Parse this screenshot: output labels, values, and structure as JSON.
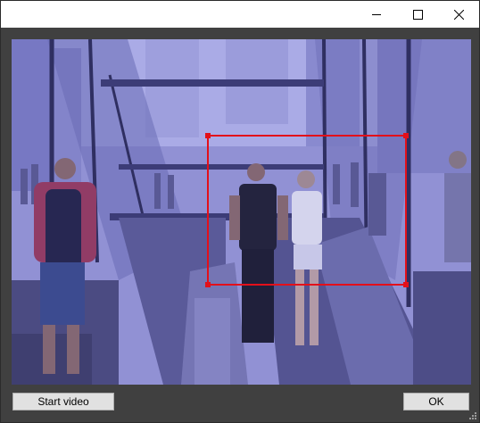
{
  "window": {
    "title": "",
    "controls": {
      "minimize": "minimize-icon",
      "maximize": "maximize-icon",
      "close": "close-icon"
    }
  },
  "video": {
    "description_icon": "video-frame",
    "selection": {
      "color": "#e3101a",
      "handles": [
        "top-left",
        "top-right",
        "bottom-left",
        "bottom-right"
      ]
    }
  },
  "buttons": {
    "start_video": "Start video",
    "ok": "OK"
  },
  "colors": {
    "frame_background": "#404040",
    "titlebar": "#ffffff",
    "selection": "#e3101a",
    "video_tint": "#8f8fd6"
  }
}
